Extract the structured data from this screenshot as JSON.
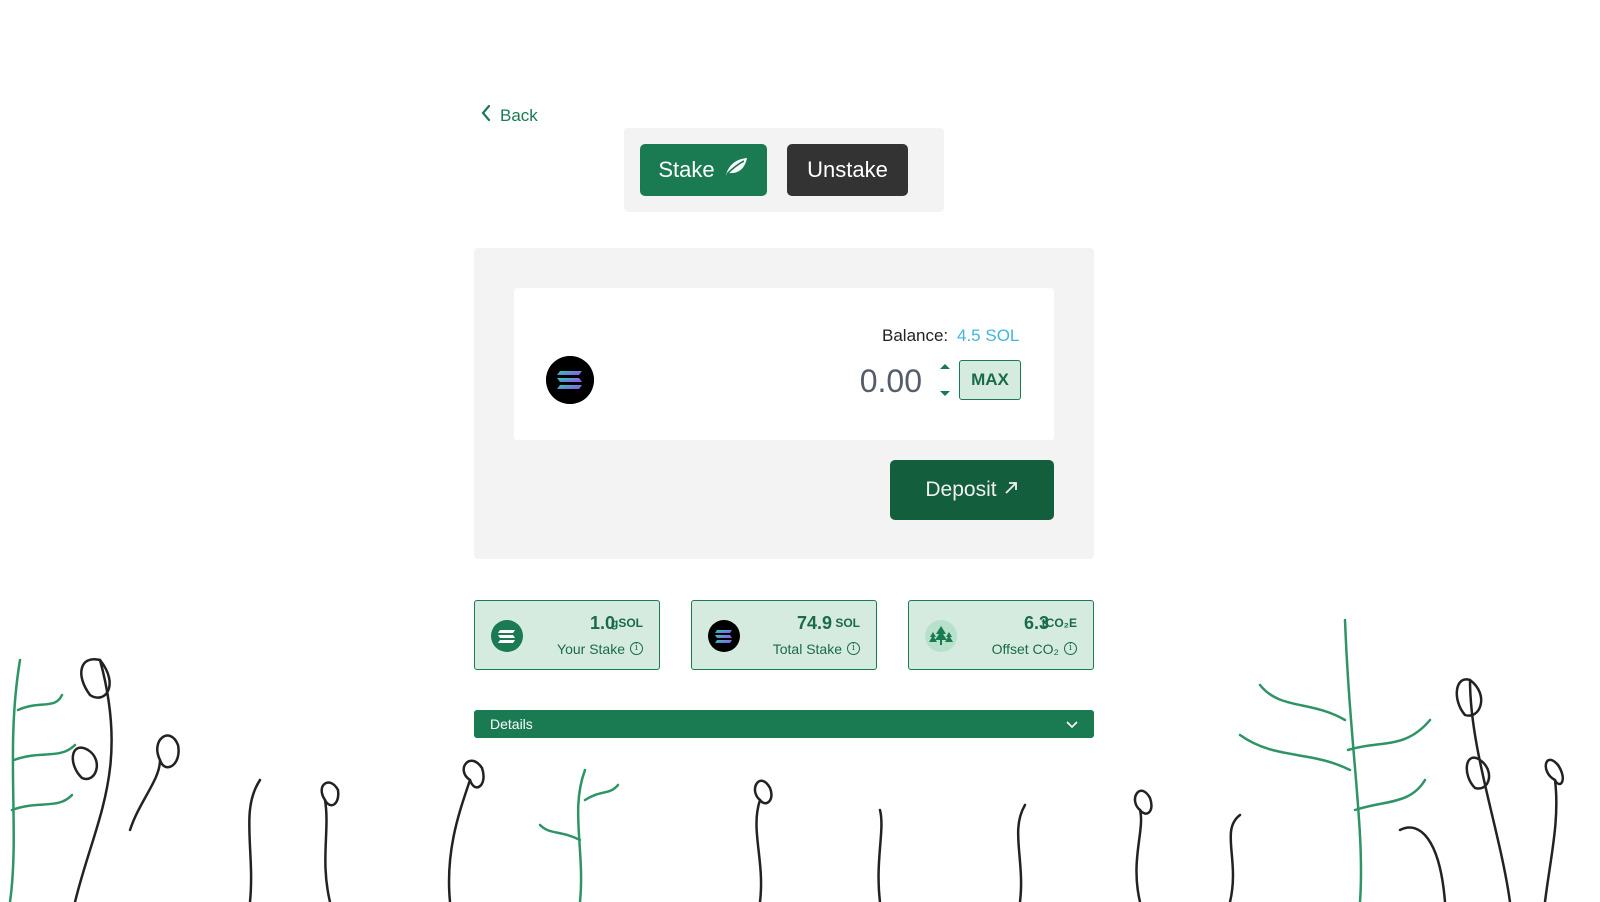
{
  "nav": {
    "back_label": "Back"
  },
  "toggle": {
    "stake_label": "Stake",
    "unstake_label": "Unstake"
  },
  "deposit_card": {
    "balance_label": "Balance:",
    "balance_value": "4.5 SOL",
    "amount_placeholder": "0.00",
    "max_label": "MAX",
    "deposit_label": "Deposit",
    "token_icon": "solana-logo-icon"
  },
  "stats": [
    {
      "value": "1.0",
      "unit": "gSOL",
      "label": "Your Stake",
      "icon": "gsol-icon"
    },
    {
      "value": "74.9",
      "unit": "SOL",
      "label": "Total Stake",
      "icon": "solana-logo-icon"
    },
    {
      "value": "6.3",
      "unit": "tCO₂E",
      "label": "Offset CO₂",
      "icon": "trees-icon"
    }
  ],
  "details": {
    "label": "Details"
  },
  "colors": {
    "brand_green": "#1a7a52",
    "dark_green": "#135e3c",
    "light_green": "#d5ebe0",
    "balance_blue": "#3fb6e0",
    "unstake_dark": "#333333",
    "panel_gray": "#f3f3f3"
  }
}
